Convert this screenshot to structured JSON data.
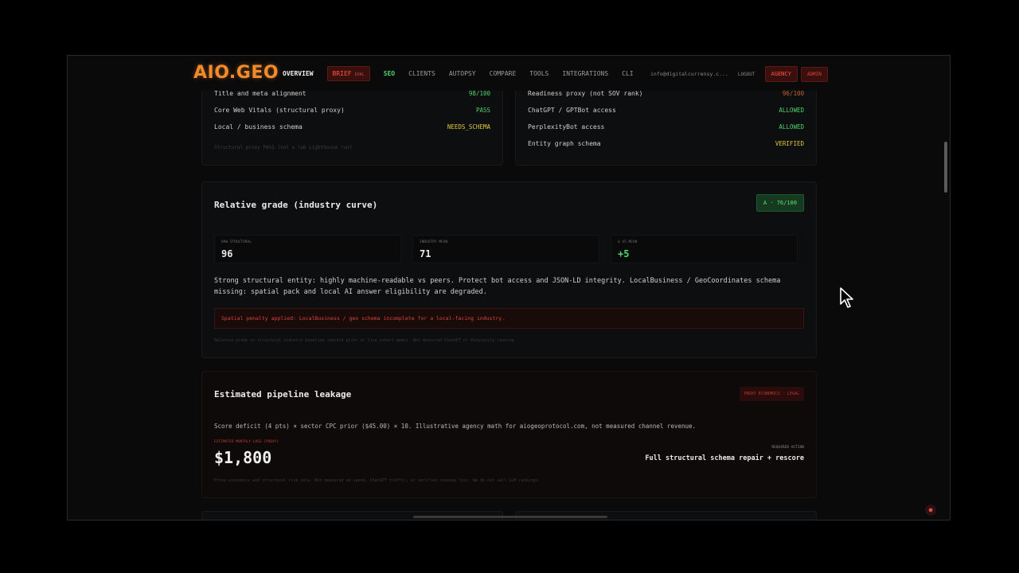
{
  "nav": {
    "logo": "AIO.GEO",
    "links": {
      "overview": "OVERVIEW",
      "brief": "BRIEF",
      "brief_tag": "DUAL",
      "seo": "SEO",
      "clients": "CLIENTS",
      "autopsy": "AUTOPSY",
      "compare": "COMPARE",
      "tools": "TOOLS",
      "integrations": "INTEGRATIONS",
      "cli": "CLI"
    },
    "email": "info@digitalcurrensy.c...",
    "logout": "LOGOUT",
    "agency": "AGENCY",
    "admin": "ADMIN"
  },
  "technical": {
    "left_rows": [
      {
        "label": "Title and meta alignment",
        "value": "98/100",
        "status": "green"
      },
      {
        "label": "Core Web Vitals (structural proxy)",
        "value": "PASS",
        "status": "green"
      },
      {
        "label": "Local / business schema",
        "value": "NEEDS_SCHEMA",
        "status": "yellow"
      }
    ],
    "left_footnote": "Structural proxy PASS (not a lab Lighthouse run)",
    "right_rows": [
      {
        "label": "Readiness proxy (not SOV rank)",
        "value": "96/100",
        "status": "orange"
      },
      {
        "label": "ChatGPT / GPTBot access",
        "value": "ALLOWED",
        "status": "green"
      },
      {
        "label": "PerplexityBot access",
        "value": "ALLOWED",
        "status": "green"
      },
      {
        "label": "Entity graph schema",
        "value": "VERIFIED",
        "status": "yellow"
      }
    ]
  },
  "grade": {
    "title": "Relative grade (industry curve)",
    "badge": "A · 76/100",
    "stats": [
      {
        "label": "RAW STRUCTURAL",
        "value": "96"
      },
      {
        "label": "INDUSTRY MEAN",
        "value": "71"
      },
      {
        "label": "Δ VS MEAN",
        "value": "+5"
      }
    ],
    "summary": "Strong structural entity: highly machine-readable vs peers. Protect bot access and JSON-LD integrity. LocalBusiness / GeoCoordinates schema missing: spatial pack and local AI answer eligibility are degraded.",
    "penalty": "Spatial penalty applied: LocalBusiness / geo schema incomplete for a local-facing industry.",
    "footnote": "Relative grade vs structural industry baseline (method prior or live cohort mean). Not measured ChatGPT or Perplexity ranking."
  },
  "leakage": {
    "title": "Estimated pipeline leakage",
    "badge": "PROXY ECONOMICS · LEGAL",
    "description": "Score deficit (4 pts) × sector CPC prior ($45.00) × 10. Illustrative agency math for aiogeoprotocol.com, not measured channel revenue.",
    "loss_label": "ESTIMATED MONTHLY LOSS (PROXY)",
    "loss_value": "$1,800",
    "action_label": "REQUIRED ACTION",
    "action": "Full structural schema repair + rescore",
    "footnote": "Proxy economics and structural risk only. Not measured ad spend, ChatGPT traffic, or verified revenue loss. We do not sell LLM rankings."
  },
  "colors": {
    "accent": "#f08a2a",
    "success": "#4ed36b",
    "warning": "#e0c93a",
    "danger": "#d8453a"
  }
}
